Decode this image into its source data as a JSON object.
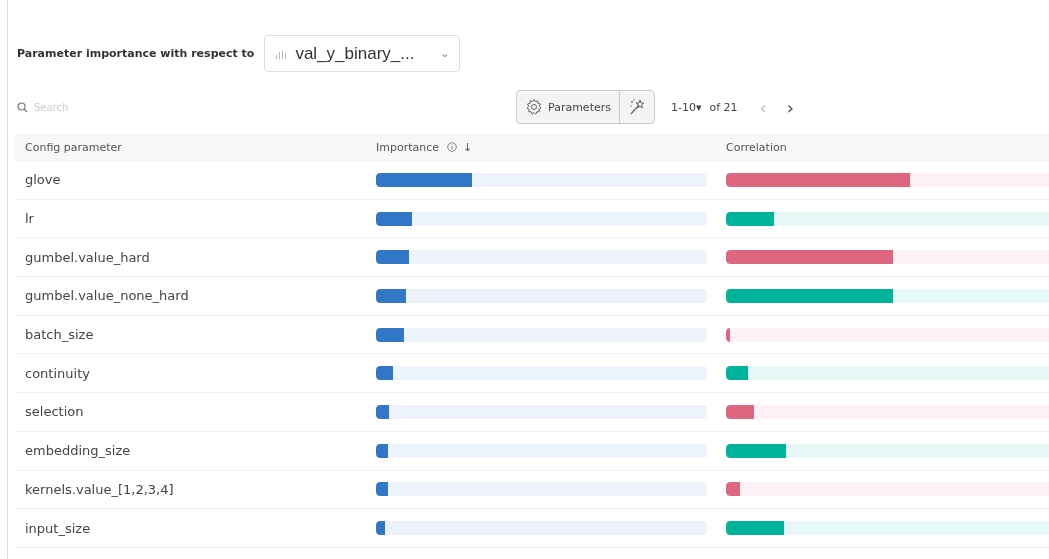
{
  "header": {
    "label": "Parameter importance with respect to",
    "metric": {
      "value": "val_y_binary_...",
      "arrow": "⌄"
    }
  },
  "search": {
    "placeholder": "Search"
  },
  "toolbar": {
    "parameters_button": "Parameters",
    "page_range": "1-10",
    "page_caret": "▾",
    "page_total": "of 21",
    "prev": "‹",
    "next": "›"
  },
  "table": {
    "columns": [
      "Config parameter",
      "Importance",
      "Correlation"
    ],
    "sort_arrow": "↓",
    "rows": [
      {
        "name": "glove",
        "importance": {
          "level": 0.29
        },
        "correlation": {
          "level": 0.54,
          "color": "#de6680"
        }
      },
      {
        "name": "lr",
        "importance": {
          "level": 0.11
        },
        "correlation": {
          "level": 0.14,
          "color": "#00b39b"
        }
      },
      {
        "name": "gumbel.value_hard",
        "importance": {
          "level": 0.1
        },
        "correlation": {
          "level": 0.49,
          "color": "#de6680"
        }
      },
      {
        "name": "gumbel.value_none_hard",
        "importance": {
          "level": 0.09
        },
        "correlation": {
          "level": 0.49,
          "color": "#00b39b"
        }
      },
      {
        "name": "batch_size",
        "importance": {
          "level": 0.085
        },
        "correlation": {
          "level": 0.012,
          "color": "#de6680"
        }
      },
      {
        "name": "continuity",
        "importance": {
          "level": 0.05
        },
        "correlation": {
          "level": 0.064,
          "color": "#00b39b"
        }
      },
      {
        "name": "selection",
        "importance": {
          "level": 0.04
        },
        "correlation": {
          "level": 0.082,
          "color": "#de6680"
        }
      },
      {
        "name": "embedding_size",
        "importance": {
          "level": 0.035
        },
        "correlation": {
          "level": 0.175,
          "color": "#00b39b"
        }
      },
      {
        "name": "kernels.value_[1,2,3,4]",
        "importance": {
          "level": 0.035
        },
        "correlation": {
          "level": 0.04,
          "color": "#de6680"
        }
      },
      {
        "name": "input_size",
        "importance": {
          "level": 0.027
        },
        "correlation": {
          "level": 0.17,
          "color": "#00b39b"
        }
      }
    ]
  }
}
